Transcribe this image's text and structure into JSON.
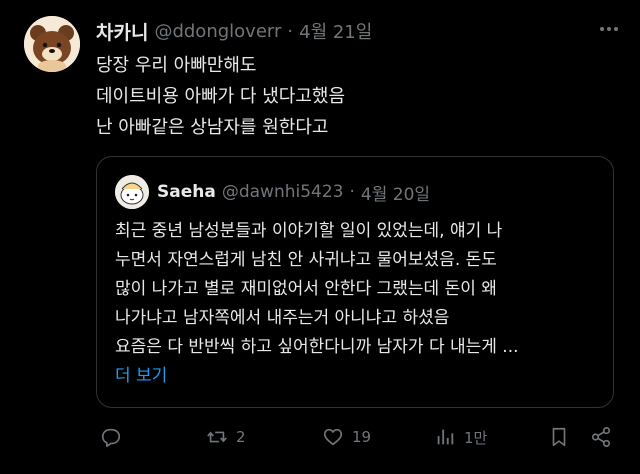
{
  "post": {
    "author_name": "차카니",
    "author_handle": "@ddongloverr",
    "separator": "·",
    "date": "4월 21일",
    "more_icon": "more-icon",
    "lines": [
      "당장 우리 아빠만해도",
      "데이트비용 아빠가 다 냈다고했음",
      "난 아빠같은 상남자를 원한다고"
    ]
  },
  "quote": {
    "author_name": "Saeha",
    "author_handle": "@dawnhi5423",
    "separator": "·",
    "date": "4월 20일",
    "lines": [
      "최근 중년 남성분들과 이야기할 일이 있었는데, 얘기 나",
      "누면서 자연스럽게 남친 안 사귀냐고 물어보셨음. 돈도",
      "많이 나가고 별로 재미없어서 안한다 그랬는데 돈이 왜",
      "나가냐고 남자쪽에서 내주는거 아니냐고 하셨음",
      "요즘은 다 반반씩 하고 싶어한다니까 남자가 다 내는게 ..."
    ],
    "show_more": "더 보기"
  },
  "actions": {
    "reply_icon": "reply-icon",
    "repost_icon": "repost-icon",
    "repost_count": "2",
    "like_icon": "heart-icon",
    "like_count": "19",
    "views_icon": "views-icon",
    "views_count": "1만",
    "bookmark_icon": "bookmark-icon",
    "share_icon": "share-icon"
  },
  "colors": {
    "background": "#000000",
    "text": "#e7e9ea",
    "muted": "#71767b",
    "link": "#1d9bf0",
    "border": "#2f3336"
  }
}
